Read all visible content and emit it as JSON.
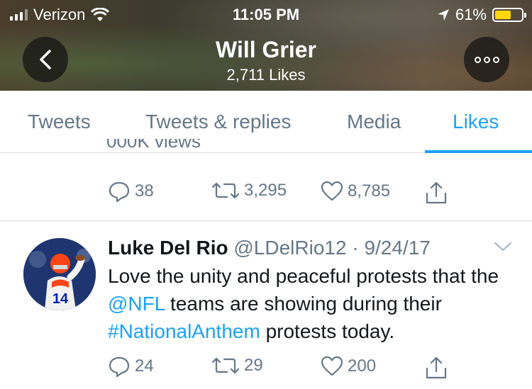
{
  "status_bar": {
    "carrier": "Verizon",
    "time": "11:05 PM",
    "battery": "61%",
    "battery_level": 0.61
  },
  "header": {
    "name": "Will Grier",
    "subtitle": "2,711 Likes"
  },
  "tabs": [
    {
      "label": "Tweets",
      "active": false
    },
    {
      "label": "Tweets & replies",
      "active": false
    },
    {
      "label": "Media",
      "active": false
    },
    {
      "label": "Likes",
      "active": true
    }
  ],
  "tweets": [
    {
      "partial_text": "000K views",
      "replies": "38",
      "retweets": "3,295",
      "likes": "8,785"
    },
    {
      "author_name": "Luke Del Rio",
      "author_handle": "@LDelRio12",
      "separator": "·",
      "date": "9/24/17",
      "text_1": "Love the unity and peaceful protests that the ",
      "mention": "@NFL",
      "text_2": " teams are showing during their ",
      "hashtag": "#NationalAnthem",
      "text_3": " protests today.",
      "replies": "24",
      "retweets": "29",
      "likes": "200"
    }
  ],
  "colors": {
    "accent": "#1da1f2",
    "secondary_text": "#657786",
    "primary_text": "#14171a",
    "battery": "#ffd60a"
  },
  "icons": [
    "back-arrow-icon",
    "more-icon",
    "reply-icon",
    "retweet-icon",
    "like-icon",
    "share-icon",
    "chevron-down-icon",
    "wifi-icon",
    "location-arrow-icon",
    "battery-icon",
    "signal-icon"
  ]
}
